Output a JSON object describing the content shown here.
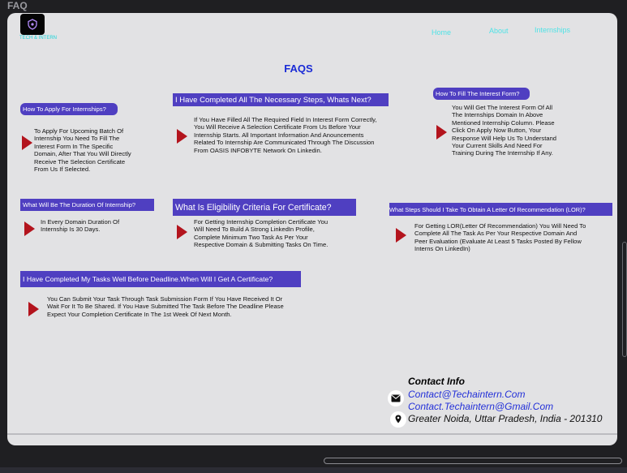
{
  "frame": {
    "title": "FAQ"
  },
  "brand": {
    "logo_text": "TECH & INTERN"
  },
  "nav": {
    "home": "Home",
    "about": "About",
    "internships": "Internships"
  },
  "page_title": "FAQS",
  "faqs": [
    {
      "question": "How To Apply For Internships?",
      "answer": "To Apply For Upcoming Batch Of Internship You Need To Fill The Interest Form In The Specific Domain, After That You Will Directly Receive The Selection Certificate From Us If Selected."
    },
    {
      "question": "I Have Completed All The Necessary Steps, Whats Next?",
      "answer": "If You Have Filled All The Required Field In Interest Form Correctly, You Will Receive A Selection Certificate From Us Before Your Internship Starts. All Important Information And Anouncements Related To Internship Are Communicated Through The Discussion From OASIS INFOBYTE Network On Linkedin."
    },
    {
      "question": "How To Fill The Interest Form?",
      "answer": "You Will Get The Interest Form Of All The Internships Domain In Above Mentioned Internship Column. Please Click On Apply Now Button, Your Response Will Help Us To Understand Your Current Skills And Need For Training During The Internship If Any."
    },
    {
      "question": "What Will Be The Duration Of Internship?",
      "answer": "In Every Domain Duration Of Internship Is 30 Days."
    },
    {
      "question": "What Is Eligibility Criteria For Certificate?",
      "answer": "For Getting Internship Completion Certificate You Will Need To Build A Strong LinkedIn Profile, Complete Minimum Two Task As Per Your Respective Domain & Submitting Tasks On Time."
    },
    {
      "question": "What Steps Should I Take To Obtain A Letter Of Recommendation (LOR)?",
      "answer": "For Getting LOR(Letter Of Recommendation) You Will Need To Complete All The Task As Per Your Respective Domain And Peer Evaluation (Evaluate At Least 5 Tasks Posted By Fellow Interns On LinkedIn)"
    },
    {
      "question": "I Have Completed My Tasks Well Before Deadline.When Will I Get A Certificate?",
      "answer": "You Can Submit Your Task Through Task Submission Form If You Have Received It Or Wait For It To Be Shared. If You Have Submitted The Task Before The Deadline Please Expect Your Completion Certificate In The 1st Week Of Next Month."
    }
  ],
  "contact": {
    "title": "Contact Info",
    "email_1": "Contact@Techaintern.Com",
    "email_2": "Contact.Techaintern@Gmail.Com",
    "address": "Greater Noida, Uttar Pradesh, India - 201310"
  },
  "icons": {
    "envelope": "envelope-icon",
    "location": "location-pin-icon",
    "arrow": "play-arrow-icon",
    "logo": "shield-logo-icon"
  },
  "colors": {
    "page_bg": "#e2e2e4",
    "question_bg": "#4f3fc1",
    "arrow": "#b3141d",
    "heading": "#1a2bd6",
    "nav": "#4fe3e6",
    "link": "#2330d8"
  }
}
